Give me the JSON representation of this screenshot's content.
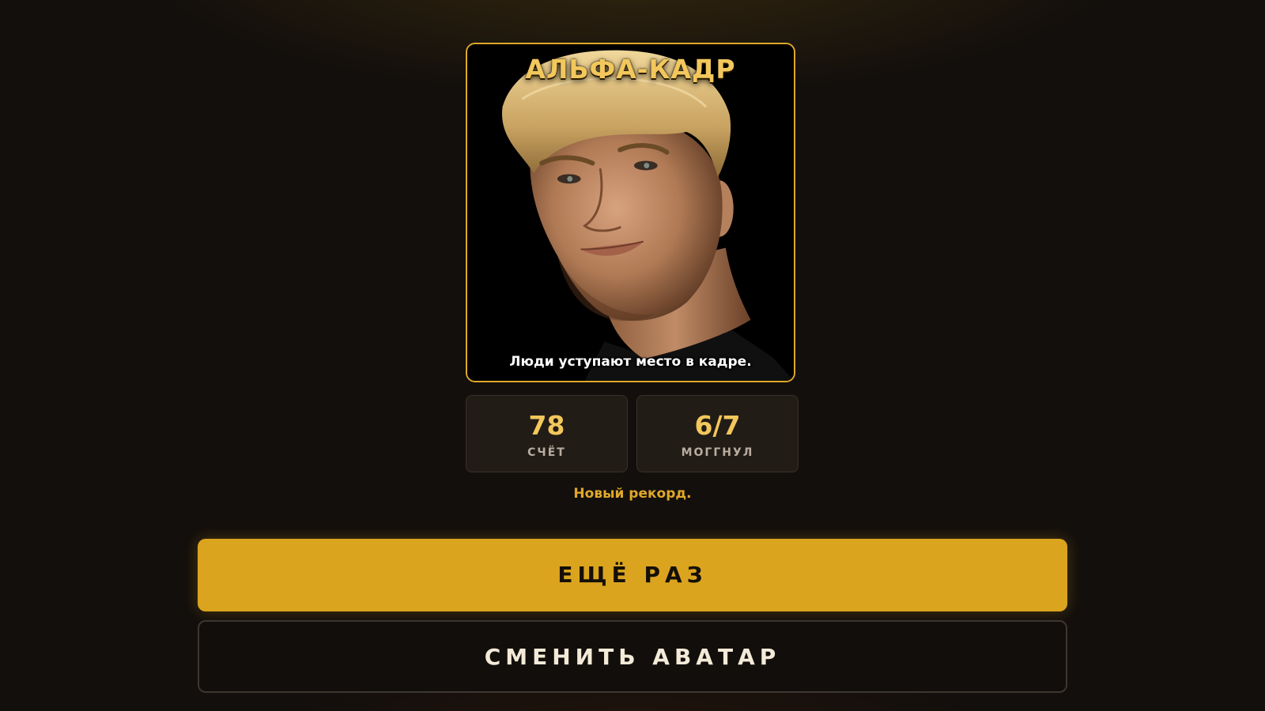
{
  "card": {
    "title": "АЛЬФА-КАДР",
    "caption": "Люди уступают место в кадре.",
    "border_color": "#e0a829"
  },
  "stats": [
    {
      "value": "78",
      "label": "СЧЁТ"
    },
    {
      "value": "6/7",
      "label": "МОГГНУЛ"
    }
  ],
  "record_text": "Новый рекорд.",
  "buttons": {
    "retry_label": "ЕЩЁ РАЗ",
    "change_avatar_label": "СМЕНИТЬ АВАТАР"
  },
  "colors": {
    "accent": "#dba41f",
    "gold_text": "#f2c75c",
    "background": "#130f0c"
  }
}
